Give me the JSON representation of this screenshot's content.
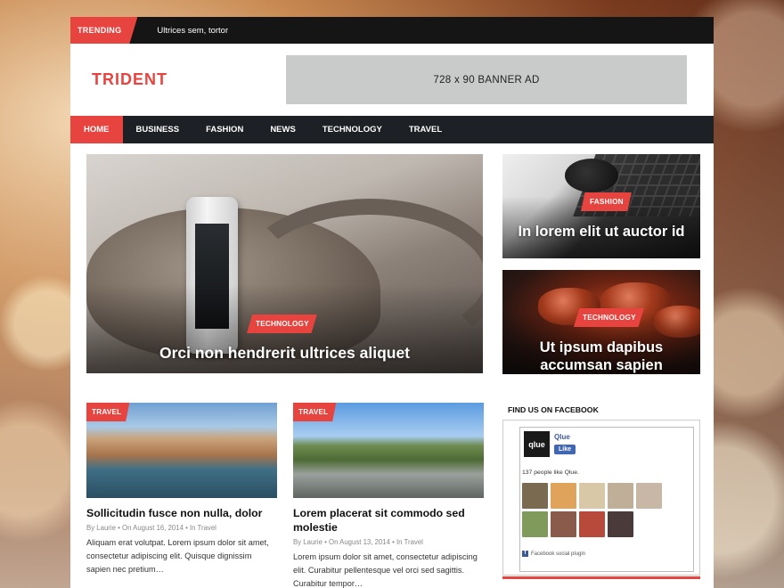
{
  "trending": {
    "label": "TRENDING",
    "text": "Ultrices sem, tortor"
  },
  "header": {
    "logo": "TRIDENT",
    "banner": "728 x 90 BANNER AD"
  },
  "nav": {
    "items": [
      "HOME",
      "BUSINESS",
      "FASHION",
      "NEWS",
      "TECHNOLOGY",
      "TRAVEL"
    ],
    "active": "HOME"
  },
  "featured": {
    "tag": "TECHNOLOGY",
    "title": "Orci non hendrerit ultrices aliquet"
  },
  "side": [
    {
      "tag": "FASHION",
      "title": "In lorem elit ut auctor id"
    },
    {
      "tag": "TECHNOLOGY",
      "title": "Ut ipsum dapibus accumsan sapien"
    }
  ],
  "posts": [
    {
      "tag": "TRAVEL",
      "title": "Sollicitudin fusce non nulla, dolor",
      "meta": "By Laurie • On August 16, 2014 • In Travel",
      "excerpt": "Aliquam erat volutpat. Lorem ipsum dolor sit amet, consectetur adipiscing elit. Quisque dignissim sapien nec pretium…"
    },
    {
      "tag": "TRAVEL",
      "title": "Lorem placerat sit commodo sed molestie",
      "meta": "By Laurie • On August 13, 2014 • In Travel",
      "excerpt": "Lorem ipsum dolor sit amet, consectetur adipiscing elit. Curabitur pellentesque vel orci sed sagittis. Curabitur tempor…"
    }
  ],
  "sidebar": {
    "heading": "FIND US ON FACEBOOK",
    "fb": {
      "page_name": "Qlue",
      "logo_text": "qlue",
      "like_label": "Like",
      "count_text": "137 people like Qlue.",
      "plugin_text": "Facebook social plugin"
    }
  },
  "colors": {
    "accent": "#e8443f",
    "nav_bg": "#1d2024",
    "trending_bg": "#151515"
  }
}
